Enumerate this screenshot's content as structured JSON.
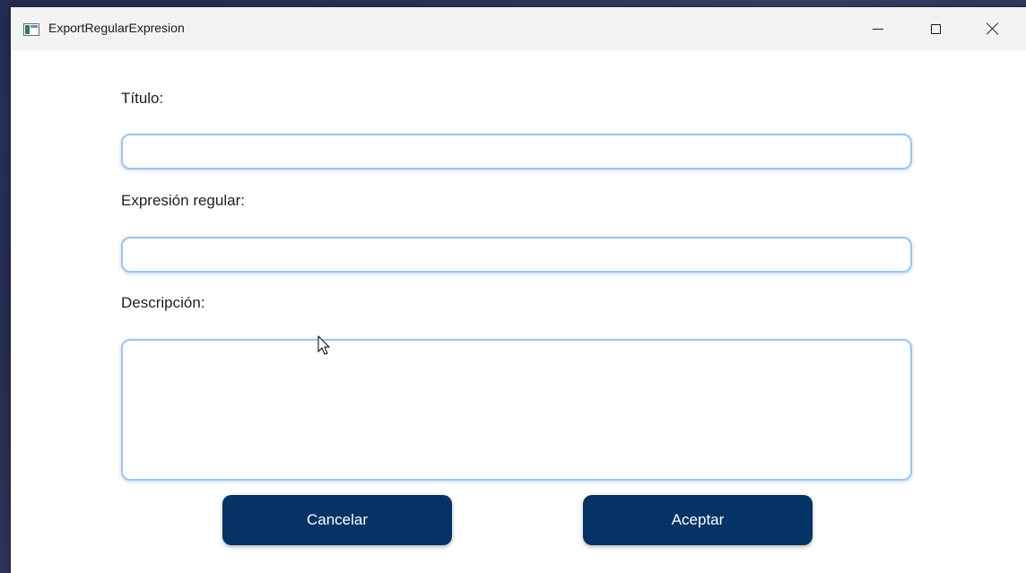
{
  "window": {
    "title": "ExportRegularExpresion",
    "icon": "app-window-icon",
    "controls": [
      "minimize-icon",
      "maximize-icon",
      "close-icon"
    ]
  },
  "form": {
    "title_label": "Título:",
    "title_value": "",
    "regex_label": "Expresión regular:",
    "regex_value": "",
    "description_label": "Descripción:",
    "description_value": ""
  },
  "buttons": {
    "cancel_label": "Cancelar",
    "accept_label": "Aceptar"
  },
  "colors": {
    "button_bg": "#063365",
    "input_border": "#9cc5ec",
    "titlebar_bg": "#f3f3f3"
  }
}
